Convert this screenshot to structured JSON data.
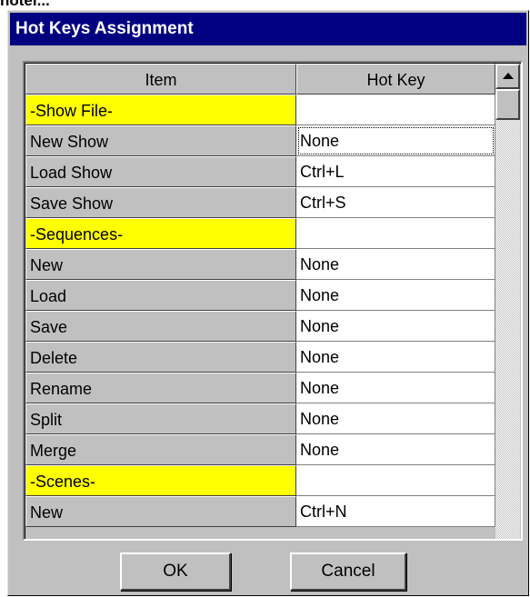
{
  "cropped_text": "hotel...",
  "dialog": {
    "title": "Hot Keys Assignment",
    "columns": {
      "item": "Item",
      "hotkey": "Hot Key"
    },
    "rows": [
      {
        "item": "-Show File-",
        "hotkey": "",
        "section": true
      },
      {
        "item": "New Show",
        "hotkey": "None",
        "section": false,
        "focused": true
      },
      {
        "item": "Load Show",
        "hotkey": "Ctrl+L",
        "section": false
      },
      {
        "item": "Save Show",
        "hotkey": "Ctrl+S",
        "section": false
      },
      {
        "item": "-Sequences-",
        "hotkey": "",
        "section": true
      },
      {
        "item": "New",
        "hotkey": "None",
        "section": false
      },
      {
        "item": "Load",
        "hotkey": "None",
        "section": false
      },
      {
        "item": "Save",
        "hotkey": "None",
        "section": false
      },
      {
        "item": "Delete",
        "hotkey": "None",
        "section": false
      },
      {
        "item": "Rename",
        "hotkey": "None",
        "section": false
      },
      {
        "item": "Split",
        "hotkey": "None",
        "section": false
      },
      {
        "item": "Merge",
        "hotkey": "None",
        "section": false
      },
      {
        "item": "-Scenes-",
        "hotkey": "",
        "section": true
      },
      {
        "item": "New",
        "hotkey": "Ctrl+N",
        "section": false
      }
    ],
    "buttons": {
      "ok": "OK",
      "cancel": "Cancel"
    }
  },
  "colors": {
    "titlebar": "#000080",
    "section_highlight": "#ffff00",
    "face": "#c0c0c0"
  },
  "icons": {
    "scroll_up": "scroll-up-arrow-icon"
  }
}
